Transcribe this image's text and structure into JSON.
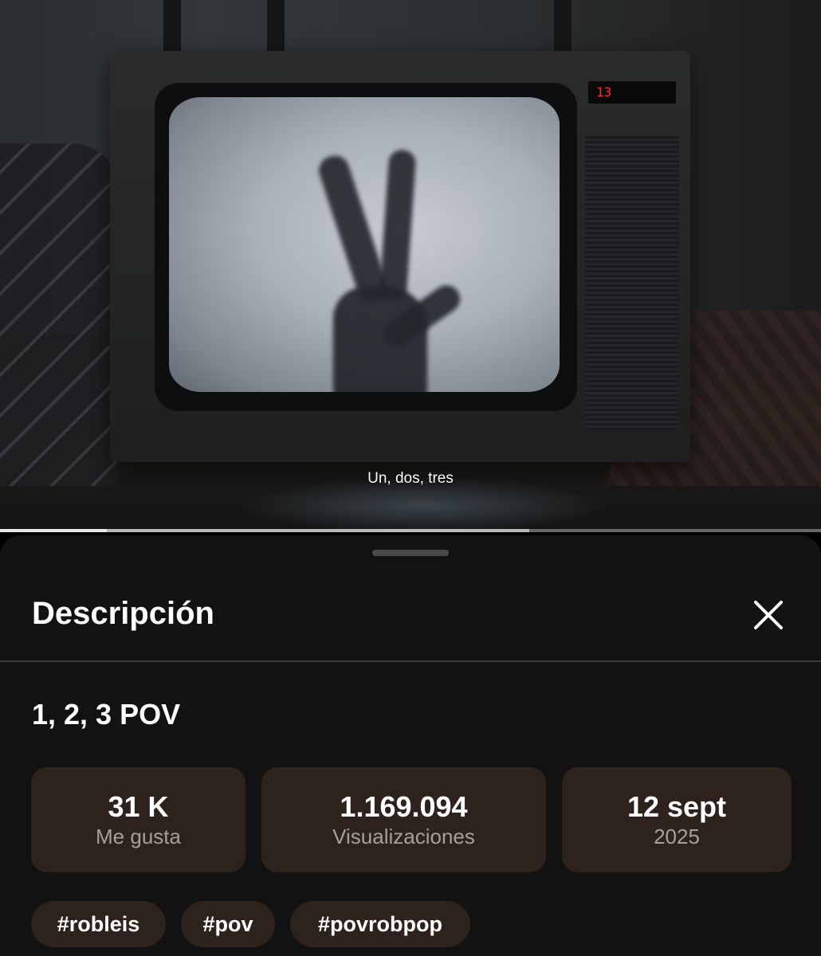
{
  "video": {
    "subtitle": "Un, dos, tres",
    "tv_channel_display": "13",
    "progress_played": 0.13,
    "progress_buffered": 0.645
  },
  "sheet": {
    "title": "Descripción",
    "close_icon": "close-icon"
  },
  "description": {
    "video_title": "1, 2, 3 POV",
    "stats": [
      {
        "value": "31 K",
        "label": "Me gusta"
      },
      {
        "value": "1.169.094",
        "label": "Visualizaciones"
      },
      {
        "value": "12 sept",
        "label": "2025"
      }
    ],
    "tags": [
      "#robleis",
      "#pov",
      "#povrobpop"
    ]
  },
  "colors": {
    "sheet_bg": "#121212",
    "chip_bg": "#2e221c",
    "secondary_text": "#a89e98"
  }
}
